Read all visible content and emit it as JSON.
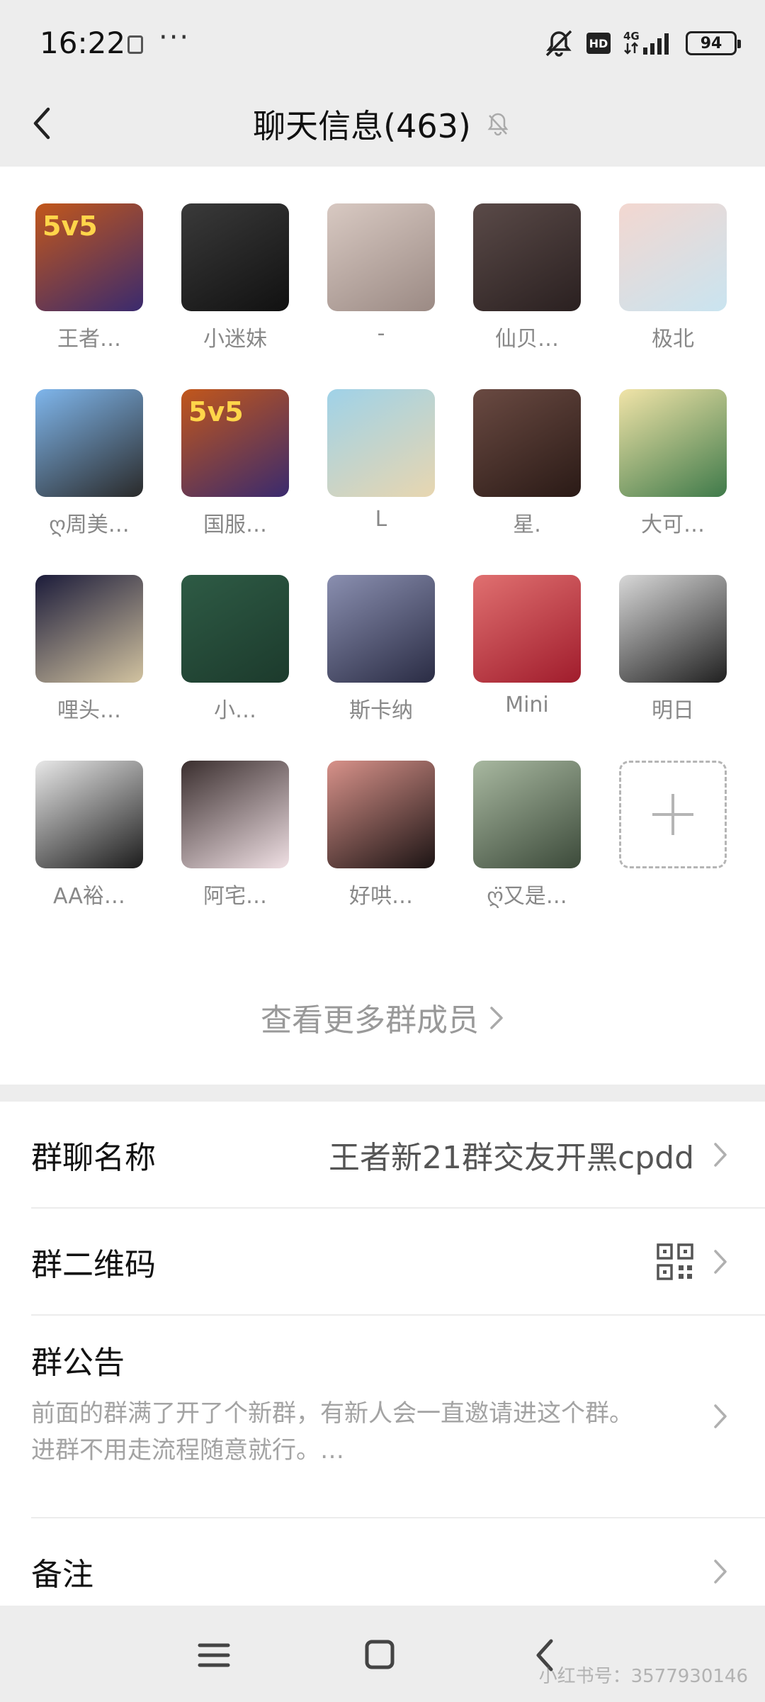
{
  "status_bar": {
    "time": "16:22",
    "network": "4G",
    "hd_label": "HD",
    "battery": "94"
  },
  "header": {
    "title": "聊天信息(463)"
  },
  "members": [
    {
      "name": "王者…",
      "colors": [
        "#c2571b",
        "#3a2a6e"
      ],
      "glyph": "5v5"
    },
    {
      "name": "小迷妹",
      "colors": [
        "#3a3a3a",
        "#111111"
      ],
      "glyph": ""
    },
    {
      "name": "-",
      "colors": [
        "#d8c9c2",
        "#9b8a84"
      ],
      "glyph": ""
    },
    {
      "name": "仙贝…",
      "colors": [
        "#5a4a48",
        "#2a2020"
      ],
      "glyph": ""
    },
    {
      "name": "极北",
      "colors": [
        "#f3d7d0",
        "#c9e4f0"
      ],
      "glyph": ""
    },
    {
      "name": "ღ周美…",
      "colors": [
        "#7fb6ec",
        "#2a2a2a"
      ],
      "glyph": ""
    },
    {
      "name": "国服…",
      "colors": [
        "#c2571b",
        "#3a2a6e"
      ],
      "glyph": "5v5"
    },
    {
      "name": "L",
      "colors": [
        "#9fd2e8",
        "#e8d6b0"
      ],
      "glyph": ""
    },
    {
      "name": "星.",
      "colors": [
        "#6a4a42",
        "#2a1a16"
      ],
      "glyph": ""
    },
    {
      "name": "大可…",
      "colors": [
        "#f1e4a8",
        "#3f7a4a"
      ],
      "glyph": ""
    },
    {
      "name": "哩头…",
      "colors": [
        "#1b1b3a",
        "#d2c3a0"
      ],
      "glyph": ""
    },
    {
      "name": "小…",
      "colors": [
        "#2e5b45",
        "#1c3a2c"
      ],
      "glyph": ""
    },
    {
      "name": "斯卡纳",
      "colors": [
        "#8a8fb0",
        "#2a2c44"
      ],
      "glyph": ""
    },
    {
      "name": "Mini",
      "colors": [
        "#e07070",
        "#a01c2c"
      ],
      "glyph": ""
    },
    {
      "name": "明日",
      "colors": [
        "#d8d8d8",
        "#202020"
      ],
      "glyph": ""
    },
    {
      "name": "AA裕…",
      "colors": [
        "#e8e8e8",
        "#1c1c1c"
      ],
      "glyph": ""
    },
    {
      "name": "阿宅…",
      "colors": [
        "#3a2e2e",
        "#f0e0e4"
      ],
      "glyph": ""
    },
    {
      "name": "好哄…",
      "colors": [
        "#d8928a",
        "#1c1414"
      ],
      "glyph": ""
    },
    {
      "name": "ღ̈又是…",
      "colors": [
        "#a8b8a0",
        "#3c4a3a"
      ],
      "glyph": ""
    }
  ],
  "more_members_label": "查看更多群成员",
  "settings": {
    "group_name_label": "群聊名称",
    "group_name_value": "王者新21群交友开黑cpdd",
    "qr_label": "群二维码",
    "notice_label": "群公告",
    "notice_text": "前面的群满了开了个新群，有新人会一直邀请进这个群。\n进群不用走流程随意就行。…",
    "remark_label": "备注"
  },
  "watermark": "小红书号：3577930146"
}
